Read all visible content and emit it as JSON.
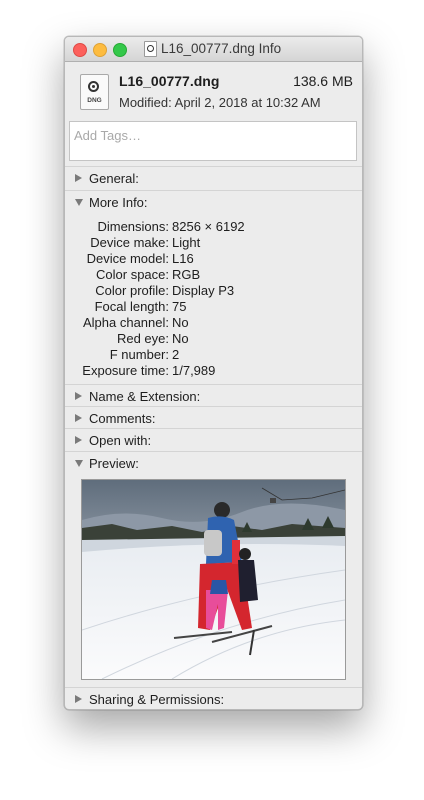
{
  "window": {
    "title": "L16_00777.dng Info"
  },
  "file": {
    "name": "L16_00777.dng",
    "size": "138.6 MB",
    "modified": "Modified: April 2, 2018 at 10:32 AM",
    "icon_ext": "DNG"
  },
  "tags": {
    "placeholder": "Add Tags…"
  },
  "sections": {
    "general": "General:",
    "more_info": "More Info:",
    "name_ext": "Name & Extension:",
    "comments": "Comments:",
    "open_with": "Open with:",
    "preview": "Preview:",
    "sharing": "Sharing & Permissions:"
  },
  "more_info": [
    {
      "key": "Dimensions:",
      "value": "8256 × 6192"
    },
    {
      "key": "Device make:",
      "value": "Light"
    },
    {
      "key": "Device model:",
      "value": "L16"
    },
    {
      "key": "Color space:",
      "value": "RGB"
    },
    {
      "key": "Color profile:",
      "value": "Display P3"
    },
    {
      "key": "Focal length:",
      "value": "75"
    },
    {
      "key": "Alpha channel:",
      "value": "No"
    },
    {
      "key": "Red eye:",
      "value": "No"
    },
    {
      "key": "F number:",
      "value": "2"
    },
    {
      "key": "Exposure time:",
      "value": "1/7,989"
    }
  ],
  "colors": {
    "close": "#fc605c",
    "minimize": "#fdbc40",
    "zoom": "#34c84a",
    "window_bg": "#ececec"
  }
}
